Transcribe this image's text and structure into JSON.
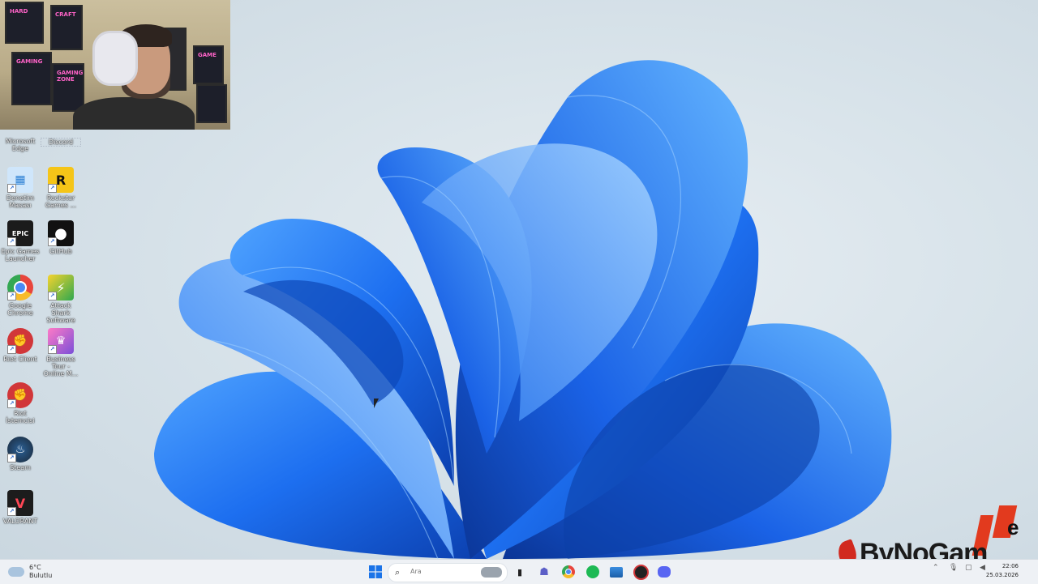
{
  "desktop_icons": [
    {
      "label": "Microsoft Edge",
      "color": "#1f6fd6",
      "glyph": "e"
    },
    {
      "label": "Discord",
      "color": "#5865f2",
      "glyph": "◉"
    },
    {
      "label": "Denetim Masası",
      "color": "#57a6e8",
      "glyph": "⚙"
    },
    {
      "label": "Rockstar Games ...",
      "color": "#f5c518",
      "glyph": "R"
    },
    {
      "label": "Epic Games Launcher",
      "color": "#1b1b1b",
      "glyph": "EPIC"
    },
    {
      "label": "GitHub",
      "color": "#111111",
      "glyph": "◐"
    },
    {
      "label": "Google Chrome",
      "color": "#e8453c",
      "glyph": "◎"
    },
    {
      "label": "Attack Shark Software",
      "color": "#f0c419",
      "glyph": "⚡"
    },
    {
      "label": "Riot Client",
      "color": "#d13639",
      "glyph": "✊"
    },
    {
      "label": "Business Tour - Online M...",
      "color": "#b05bd6",
      "glyph": "♛"
    },
    {
      "label": "Riot İstemcisi",
      "color": "#d13639",
      "glyph": "✊"
    },
    {
      "label": "Steam",
      "color": "#1b2838",
      "glyph": "♨"
    },
    {
      "label": "VALORANT",
      "color": "#1c1c1c",
      "glyph": "V"
    }
  ],
  "taskbar": {
    "weather_temp": "6°C",
    "weather_desc": "Bulutlu",
    "search_placeholder": "Ara",
    "clock_time": "22:06",
    "clock_date": "25.03.2026"
  },
  "watermark": {
    "text": "ByNoGam",
    "suffix": "e"
  },
  "webcam_posters": [
    "HARD",
    "GAMING",
    "CRAFT",
    "GAMING ZONE",
    "GAME"
  ],
  "colors": {
    "taskbar_bg": "#eef1f5",
    "wallpaper_blue": "#1666e0",
    "watermark_red": "#e23a1e"
  }
}
